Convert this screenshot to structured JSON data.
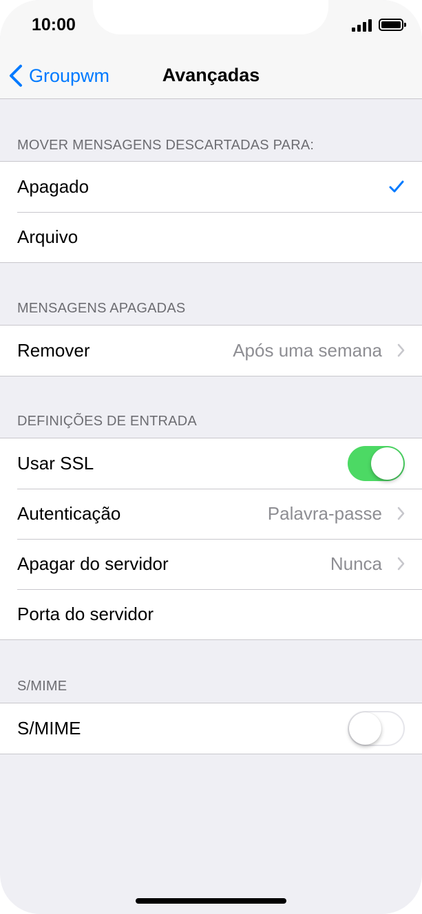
{
  "status_bar": {
    "time": "10:00"
  },
  "nav": {
    "back_label": "Groupwm",
    "title": "Avançadas"
  },
  "sections": {
    "move_messages": {
      "header": "MOVER MENSAGENS DESCARTADAS PARA:",
      "rows": [
        {
          "label": "Apagado",
          "checked": true
        },
        {
          "label": "Arquivo",
          "checked": false
        }
      ]
    },
    "deleted_messages": {
      "header": "MENSAGENS APAGADAS",
      "rows": [
        {
          "label": "Remover",
          "value": "Após uma semana"
        }
      ]
    },
    "incoming_settings": {
      "header": "DEFINIÇÕES DE ENTRADA",
      "rows": [
        {
          "label": "Usar SSL",
          "toggle_on": true
        },
        {
          "label": "Autenticação",
          "value": "Palavra-passe"
        },
        {
          "label": "Apagar do servidor",
          "value": "Nunca"
        },
        {
          "label": "Porta do servidor",
          "value": ""
        }
      ]
    },
    "smime": {
      "header": "S/MIME",
      "rows": [
        {
          "label": "S/MIME",
          "toggle_on": false
        }
      ]
    }
  },
  "colors": {
    "accent": "#007aff",
    "toggle_on": "#4cd964",
    "background": "#efeff4",
    "secondary_text": "#8e8e93"
  }
}
